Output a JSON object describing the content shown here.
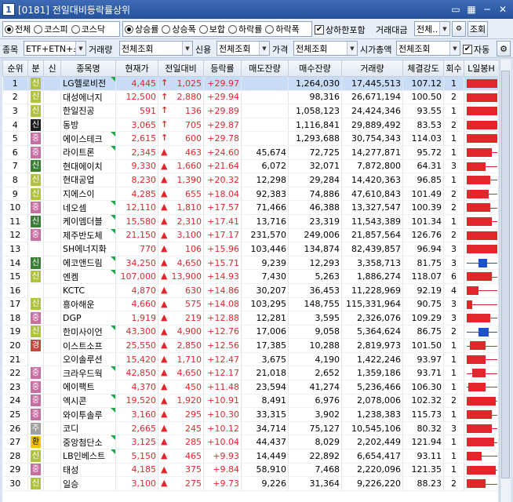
{
  "window": {
    "num": "1",
    "title": "[0181] 전일대비등락률상위",
    "ctrl_icons": [
      "window-icon",
      "grid-icon",
      "minimize-icon",
      "close-icon"
    ]
  },
  "filters": {
    "market": [
      "전체",
      "코스피",
      "코스닥"
    ],
    "market_selected": 0,
    "direction": [
      "상승률",
      "상승폭",
      "보합",
      "하락률",
      "하락폭"
    ],
    "direction_selected": 0,
    "limit_include_label": "상하한포함",
    "limit_include_checked": true,
    "trade_amount_label": "거래대금",
    "trade_amount_value": "전체..",
    "query_button": "조회",
    "item_label": "종목",
    "item_value": "ETF+ETN+스",
    "volume_label": "거래량",
    "volume_value": "전체조회",
    "credit_label": "신용",
    "credit_value": "전체조회",
    "price_label": "가격",
    "price_value": "전체조회",
    "mcap_label": "시가총액",
    "mcap_value": "전체조회",
    "auto_label": "자동",
    "auto_checked": true
  },
  "columns": [
    "순위",
    "분",
    "신",
    "종목명",
    "현재가",
    "전일대비",
    "등락률",
    "매도잔량",
    "매수잔량",
    "거래량",
    "체결강도",
    "회수",
    "L일봉H"
  ],
  "colors": {
    "up": "#e3262b",
    "blue": "#1f4fd1",
    "selected_row": "#c9dcf5"
  },
  "rows": [
    {
      "rank": "1",
      "div": "신",
      "divc": "b-sin",
      "name": "LG헬로비전",
      "price": "4,445",
      "arrow": "up-arrow",
      "chg": "1,025",
      "rate": "+29.97",
      "ask": "",
      "bid": "1,264,030",
      "vol": "17,445,513",
      "str": "107.12",
      "cnt": "1",
      "tri": true,
      "c": {
        "s": 0.05,
        "e": 1.0,
        "b0": 0.05,
        "b1": 0.95,
        "col": "up"
      }
    },
    {
      "rank": "2",
      "div": "신",
      "divc": "b-sin",
      "name": "대성에너지",
      "price": "12,500",
      "arrow": "up-arrow",
      "chg": "2,880",
      "rate": "+29.94",
      "ask": "",
      "bid": "98,316",
      "vol": "26,671,194",
      "str": "100.50",
      "cnt": "2",
      "tri": false,
      "c": {
        "s": 0.05,
        "e": 1.0,
        "b0": 0.05,
        "b1": 0.95,
        "col": "up"
      }
    },
    {
      "rank": "3",
      "div": "신",
      "divc": "b-sin",
      "name": "한일진공",
      "price": "591",
      "arrow": "up-arrow",
      "chg": "136",
      "rate": "+29.89",
      "ask": "",
      "bid": "1,058,123",
      "vol": "24,424,346",
      "str": "93.55",
      "cnt": "1",
      "tri": false,
      "c": {
        "s": 0.05,
        "e": 1.0,
        "b0": 0.05,
        "b1": 0.95,
        "col": "up"
      }
    },
    {
      "rank": "4",
      "div": "신",
      "divc": "b-sin-k",
      "name": "동방",
      "price": "3,065",
      "arrow": "up-arrow",
      "chg": "705",
      "rate": "+29.87",
      "ask": "",
      "bid": "1,116,841",
      "vol": "29,889,492",
      "str": "83.53",
      "cnt": "2",
      "tri": false,
      "c": {
        "s": 0.05,
        "e": 1.0,
        "b0": 0.05,
        "b1": 0.95,
        "col": "up"
      }
    },
    {
      "rank": "5",
      "div": "중",
      "divc": "b-jung",
      "name": "에이스테크",
      "price": "2,615",
      "arrow": "up-arrow",
      "chg": "600",
      "rate": "+29.78",
      "ask": "",
      "bid": "1,293,688",
      "vol": "30,754,343",
      "str": "114.03",
      "cnt": "1",
      "tri": true,
      "c": {
        "s": 0.05,
        "e": 1.0,
        "b0": 0.05,
        "b1": 0.95,
        "col": "up"
      }
    },
    {
      "rank": "6",
      "div": "중",
      "divc": "b-jung",
      "name": "라이트론",
      "price": "2,345",
      "arrow": "up-tri",
      "chg": "463",
      "rate": "+24.60",
      "ask": "45,674",
      "bid": "72,725",
      "vol": "14,277,871",
      "str": "95.72",
      "cnt": "1",
      "tri": true,
      "c": {
        "s": 0.05,
        "e": 1.0,
        "b0": 0.05,
        "b1": 0.8,
        "col": "up"
      }
    },
    {
      "rank": "7",
      "div": "신",
      "divc": "b-sin2",
      "name": "현대에이치",
      "price": "9,330",
      "arrow": "up-tri",
      "chg": "1,660",
      "rate": "+21.64",
      "ask": "6,072",
      "bid": "32,071",
      "vol": "7,872,800",
      "str": "64.31",
      "cnt": "3",
      "tri": false,
      "c": {
        "s": 0.05,
        "e": 1.0,
        "b0": 0.05,
        "b1": 0.6,
        "col": "up"
      }
    },
    {
      "rank": "8",
      "div": "신",
      "divc": "b-sin",
      "name": "현대공업",
      "price": "8,230",
      "arrow": "up-tri",
      "chg": "1,390",
      "rate": "+20.32",
      "ask": "12,298",
      "bid": "29,284",
      "vol": "14,420,363",
      "str": "96.85",
      "cnt": "1",
      "tri": false,
      "c": {
        "s": 0.05,
        "e": 1.0,
        "b0": 0.05,
        "b1": 0.75,
        "col": "up"
      }
    },
    {
      "rank": "9",
      "div": "신",
      "divc": "b-sin",
      "name": "지에스이",
      "price": "4,285",
      "arrow": "up-tri",
      "chg": "655",
      "rate": "+18.04",
      "ask": "92,383",
      "bid": "74,886",
      "vol": "47,610,843",
      "str": "101.49",
      "cnt": "2",
      "tri": false,
      "c": {
        "s": 0.05,
        "e": 1.0,
        "b0": 0.05,
        "b1": 0.7,
        "col": "up"
      }
    },
    {
      "rank": "10",
      "div": "중",
      "divc": "b-jung",
      "name": "네오셈",
      "price": "12,110",
      "arrow": "up-tri",
      "chg": "1,810",
      "rate": "+17.57",
      "ask": "71,466",
      "bid": "46,388",
      "vol": "13,327,547",
      "str": "100.39",
      "cnt": "2",
      "tri": true,
      "c": {
        "s": 0.05,
        "e": 1.0,
        "b0": 0.05,
        "b1": 0.75,
        "col": "up"
      }
    },
    {
      "rank": "11",
      "div": "신",
      "divc": "b-sin2",
      "name": "케이엠더블",
      "price": "15,580",
      "arrow": "up-tri",
      "chg": "2,310",
      "rate": "+17.41",
      "ask": "13,716",
      "bid": "23,319",
      "vol": "11,543,389",
      "str": "101.34",
      "cnt": "1",
      "tri": true,
      "c": {
        "s": 0.05,
        "e": 1.0,
        "b0": 0.05,
        "b1": 0.8,
        "col": "up"
      }
    },
    {
      "rank": "12",
      "div": "중",
      "divc": "b-jung",
      "name": "제주반도체",
      "price": "21,150",
      "arrow": "up-tri",
      "chg": "3,100",
      "rate": "+17.17",
      "ask": "231,570",
      "bid": "249,006",
      "vol": "21,857,564",
      "str": "126.76",
      "cnt": "2",
      "tri": true,
      "c": {
        "s": 0.05,
        "e": 1.0,
        "b0": 0.05,
        "b1": 0.95,
        "col": "up"
      }
    },
    {
      "rank": "13",
      "div": "",
      "divc": "",
      "name": "SH에너지화",
      "price": "770",
      "arrow": "up-tri",
      "chg": "106",
      "rate": "+15.96",
      "ask": "103,446",
      "bid": "134,874",
      "vol": "82,439,857",
      "str": "96.94",
      "cnt": "3",
      "tri": false,
      "c": {
        "s": 0.05,
        "e": 1.0,
        "b0": 0.05,
        "b1": 0.95,
        "col": "up"
      }
    },
    {
      "rank": "14",
      "div": "신",
      "divc": "b-sin2",
      "name": "에코앤드림",
      "price": "34,250",
      "arrow": "up-tri",
      "chg": "4,650",
      "rate": "+15.71",
      "ask": "9,239",
      "bid": "12,293",
      "vol": "3,358,713",
      "str": "81.75",
      "cnt": "3",
      "tri": true,
      "c": {
        "s": 0.05,
        "e": 1.0,
        "b0": 0.4,
        "b1": 0.65,
        "col": "blue"
      }
    },
    {
      "rank": "15",
      "div": "신",
      "divc": "b-sin",
      "name": "엔켐",
      "price": "107,000",
      "arrow": "up-tri",
      "chg": "13,900",
      "rate": "+14.93",
      "ask": "7,430",
      "bid": "5,263",
      "vol": "1,886,274",
      "str": "118.07",
      "cnt": "6",
      "tri": true,
      "c": {
        "s": 0.05,
        "e": 1.0,
        "b0": 0.05,
        "b1": 0.8,
        "col": "up"
      }
    },
    {
      "rank": "16",
      "div": "",
      "divc": "",
      "name": "KCTC",
      "price": "4,870",
      "arrow": "up-tri",
      "chg": "630",
      "rate": "+14.86",
      "ask": "30,207",
      "bid": "36,453",
      "vol": "11,228,969",
      "str": "92.19",
      "cnt": "4",
      "tri": false,
      "c": {
        "s": 0.05,
        "e": 1.0,
        "b0": 0.05,
        "b1": 0.4,
        "col": "up"
      }
    },
    {
      "rank": "17",
      "div": "신",
      "divc": "b-sin",
      "name": "흥아해운",
      "price": "4,660",
      "arrow": "up-tri",
      "chg": "575",
      "rate": "+14.08",
      "ask": "103,295",
      "bid": "148,755",
      "vol": "115,331,964",
      "str": "90.75",
      "cnt": "3",
      "tri": false,
      "c": {
        "s": 0.05,
        "e": 1.0,
        "b0": 0.05,
        "b1": 0.2,
        "col": "up"
      }
    },
    {
      "rank": "18",
      "div": "중",
      "divc": "b-jung",
      "name": "DGP",
      "price": "1,919",
      "arrow": "up-tri",
      "chg": "219",
      "rate": "+12.88",
      "ask": "12,281",
      "bid": "3,595",
      "vol": "2,326,076",
      "str": "109.29",
      "cnt": "3",
      "tri": false,
      "c": {
        "s": 0.05,
        "e": 1.0,
        "b0": 0.05,
        "b1": 0.75,
        "col": "up"
      }
    },
    {
      "rank": "19",
      "div": "신",
      "divc": "b-sin",
      "name": "한미사이언",
      "price": "43,300",
      "arrow": "up-tri",
      "chg": "4,900",
      "rate": "+12.76",
      "ask": "17,006",
      "bid": "9,058",
      "vol": "5,364,624",
      "str": "86.75",
      "cnt": "2",
      "tri": true,
      "c": {
        "s": 0.05,
        "e": 1.0,
        "b0": 0.4,
        "b1": 0.7,
        "col": "blue"
      }
    },
    {
      "rank": "20",
      "div": "경",
      "divc": "b-kyung",
      "name": "이스트소프",
      "price": "25,550",
      "arrow": "up-tri",
      "chg": "2,850",
      "rate": "+12.56",
      "ask": "17,385",
      "bid": "10,288",
      "vol": "2,819,973",
      "str": "101.50",
      "cnt": "1",
      "tri": false,
      "c": {
        "s": 0.05,
        "e": 1.0,
        "b0": 0.15,
        "b1": 0.6,
        "col": "up"
      }
    },
    {
      "rank": "21",
      "div": "",
      "divc": "",
      "name": "오이솔루션",
      "price": "15,420",
      "arrow": "up-tri",
      "chg": "1,710",
      "rate": "+12.47",
      "ask": "3,675",
      "bid": "4,190",
      "vol": "1,422,246",
      "str": "93.97",
      "cnt": "1",
      "tri": false,
      "c": {
        "s": 0.05,
        "e": 1.0,
        "b0": 0.05,
        "b1": 0.6,
        "col": "up"
      }
    },
    {
      "rank": "22",
      "div": "중",
      "divc": "b-jung",
      "name": "크라우드웍",
      "price": "42,850",
      "arrow": "up-tri",
      "chg": "4,650",
      "rate": "+12.17",
      "ask": "21,018",
      "bid": "2,652",
      "vol": "1,359,186",
      "str": "93.71",
      "cnt": "1",
      "tri": true,
      "c": {
        "s": 0.05,
        "e": 1.0,
        "b0": 0.2,
        "b1": 0.6,
        "col": "up"
      }
    },
    {
      "rank": "23",
      "div": "중",
      "divc": "b-jung",
      "name": "에이팩트",
      "price": "4,370",
      "arrow": "up-tri",
      "chg": "450",
      "rate": "+11.48",
      "ask": "23,594",
      "bid": "41,274",
      "vol": "5,236,466",
      "str": "106.30",
      "cnt": "1",
      "tri": false,
      "c": {
        "s": 0.05,
        "e": 1.0,
        "b0": 0.1,
        "b1": 0.6,
        "col": "up"
      }
    },
    {
      "rank": "24",
      "div": "중",
      "divc": "b-jung",
      "name": "엑시콘",
      "price": "19,520",
      "arrow": "up-tri",
      "chg": "1,920",
      "rate": "+10.91",
      "ask": "8,491",
      "bid": "6,976",
      "vol": "2,078,006",
      "str": "102.32",
      "cnt": "2",
      "tri": true,
      "c": {
        "s": 0.05,
        "e": 1.0,
        "b0": 0.05,
        "b1": 0.9,
        "col": "up"
      }
    },
    {
      "rank": "25",
      "div": "중",
      "divc": "b-jung",
      "name": "와이투솔루",
      "price": "3,160",
      "arrow": "up-tri",
      "chg": "295",
      "rate": "+10.30",
      "ask": "33,315",
      "bid": "3,902",
      "vol": "1,238,383",
      "str": "115.73",
      "cnt": "1",
      "tri": true,
      "c": {
        "s": 0.05,
        "e": 1.0,
        "b0": 0.05,
        "b1": 0.8,
        "col": "up"
      }
    },
    {
      "rank": "26",
      "div": "주",
      "divc": "b-ju",
      "name": "코디",
      "price": "2,665",
      "arrow": "up-tri",
      "chg": "245",
      "rate": "+10.12",
      "ask": "34,714",
      "bid": "75,127",
      "vol": "10,545,106",
      "str": "80.32",
      "cnt": "3",
      "tri": false,
      "c": {
        "s": 0.05,
        "e": 1.0,
        "b0": 0.05,
        "b1": 0.8,
        "col": "up"
      }
    },
    {
      "rank": "27",
      "div": "환",
      "divc": "b-hwan",
      "name": "중앙첨단소",
      "price": "3,125",
      "arrow": "up-tri",
      "chg": "285",
      "rate": "+10.04",
      "ask": "44,437",
      "bid": "8,029",
      "vol": "2,202,449",
      "str": "121.94",
      "cnt": "1",
      "tri": true,
      "c": {
        "s": 0.05,
        "e": 1.0,
        "b0": 0.05,
        "b1": 0.85,
        "col": "up"
      }
    },
    {
      "rank": "28",
      "div": "신",
      "divc": "b-sin",
      "name": "LB인베스트",
      "price": "5,150",
      "arrow": "up-tri",
      "chg": "465",
      "rate": "+9.93",
      "ask": "14,449",
      "bid": "22,892",
      "vol": "6,654,417",
      "str": "93.11",
      "cnt": "1",
      "tri": true,
      "c": {
        "s": 0.05,
        "e": 1.0,
        "b0": 0.05,
        "b1": 0.5,
        "col": "up"
      }
    },
    {
      "rank": "29",
      "div": "중",
      "divc": "b-jung",
      "name": "태성",
      "price": "4,185",
      "arrow": "up-tri",
      "chg": "375",
      "rate": "+9.84",
      "ask": "58,910",
      "bid": "7,468",
      "vol": "2,220,096",
      "str": "121.35",
      "cnt": "1",
      "tri": false,
      "c": {
        "s": 0.05,
        "e": 1.0,
        "b0": 0.05,
        "b1": 0.9,
        "col": "up"
      }
    },
    {
      "rank": "30",
      "div": "신",
      "divc": "b-sin",
      "name": "일승",
      "price": "3,100",
      "arrow": "up-tri",
      "chg": "275",
      "rate": "+9.73",
      "ask": "9,226",
      "bid": "31,364",
      "vol": "9,226,220",
      "str": "88.23",
      "cnt": "2",
      "tri": false,
      "c": {
        "s": 0.05,
        "e": 1.0,
        "b0": 0.05,
        "b1": 0.6,
        "col": "up"
      }
    }
  ]
}
